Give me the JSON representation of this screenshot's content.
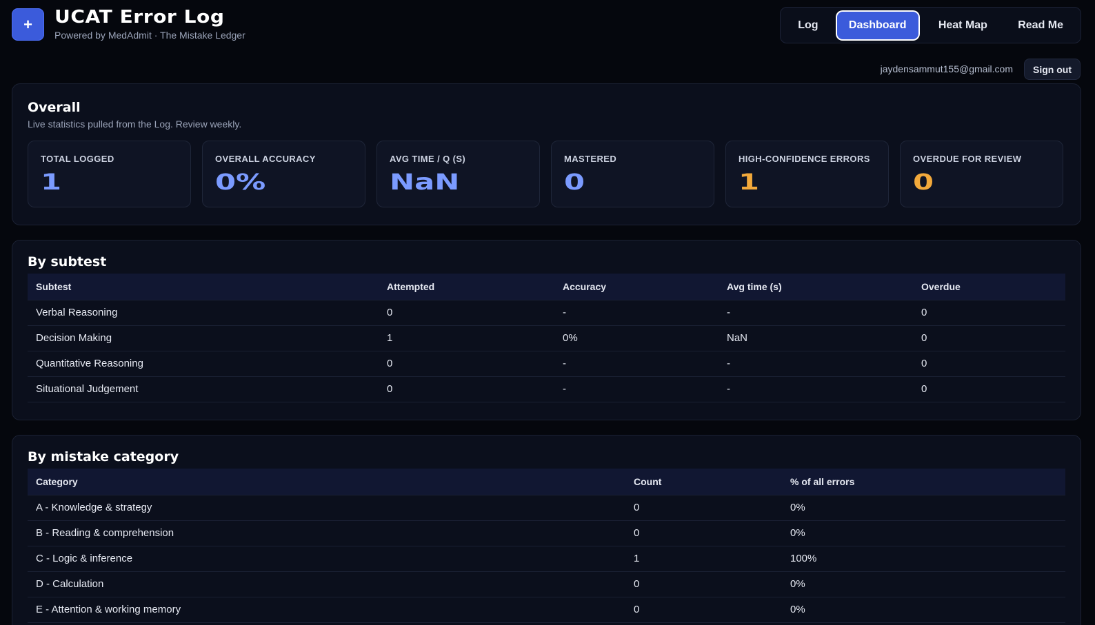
{
  "header": {
    "logo_glyph": "+",
    "title": "UCAT Error Log",
    "subtitle": "Powered by MedAdmit · The Mistake Ledger",
    "nav": [
      {
        "label": "Log"
      },
      {
        "label": "Dashboard",
        "active": true
      },
      {
        "label": "Heat Map"
      },
      {
        "label": "Read Me"
      }
    ],
    "user_email": "jaydensammut155@gmail.com",
    "signout_label": "Sign out"
  },
  "overall": {
    "title": "Overall",
    "description": "Live statistics pulled from the Log. Review weekly.",
    "stats": [
      {
        "label": "TOTAL LOGGED",
        "value": "1",
        "color": "#7b9bff"
      },
      {
        "label": "OVERALL ACCURACY",
        "value": "0%",
        "color": "#7b9bff"
      },
      {
        "label": "AVG TIME / Q (S)",
        "value": "NaN",
        "color": "#7b9bff"
      },
      {
        "label": "MASTERED",
        "value": "0",
        "color": "#7b9bff"
      },
      {
        "label": "HIGH-CONFIDENCE ERRORS",
        "value": "1",
        "color": "#f2a93b"
      },
      {
        "label": "OVERDUE FOR REVIEW",
        "value": "0",
        "color": "#f2a93b"
      }
    ]
  },
  "by_subtest": {
    "title": "By subtest",
    "columns": [
      "Subtest",
      "Attempted",
      "Accuracy",
      "Avg time (s)",
      "Overdue"
    ],
    "rows": [
      [
        "Verbal Reasoning",
        "0",
        "-",
        "-",
        "0"
      ],
      [
        "Decision Making",
        "1",
        "0%",
        "NaN",
        "0"
      ],
      [
        "Quantitative Reasoning",
        "0",
        "-",
        "-",
        "0"
      ],
      [
        "Situational Judgement",
        "0",
        "-",
        "-",
        "0"
      ]
    ]
  },
  "by_category": {
    "title": "By mistake category",
    "columns": [
      "Category",
      "Count",
      "% of all errors"
    ],
    "rows": [
      [
        "A - Knowledge & strategy",
        "0",
        "0%"
      ],
      [
        "B - Reading & comprehension",
        "0",
        "0%"
      ],
      [
        "C - Logic & inference",
        "1",
        "100%"
      ],
      [
        "D - Calculation",
        "0",
        "0%"
      ],
      [
        "E - Attention & working memory",
        "0",
        "0%"
      ]
    ]
  },
  "colors": {
    "accent": "#3b5bdb",
    "stat_blue": "#7b9bff",
    "stat_amber": "#f2a93b",
    "background": "#05070d",
    "panel": "#0b0f1c"
  }
}
